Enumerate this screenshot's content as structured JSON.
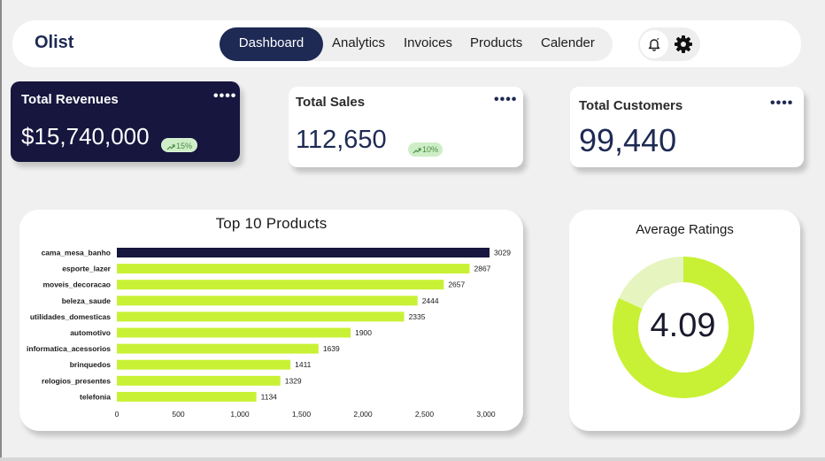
{
  "header": {
    "brand": "Olist",
    "nav": [
      "Dashboard",
      "Analytics",
      "Invoices",
      "Products",
      "Calender"
    ],
    "active_index": 0
  },
  "icons": [
    "bell-icon",
    "gear-icon",
    "more-dots-icon",
    "trend-up-icon"
  ],
  "colors": {
    "navy": "#1e2a54",
    "dark_card": "#16163f",
    "lime": "#c8f135",
    "lime_light": "#e6f5c0"
  },
  "cards": [
    {
      "title": "Total Revenues",
      "dots": "••••",
      "value": "$15,740,000",
      "badge": "15%"
    },
    {
      "title": "Total Sales",
      "dots": "••••",
      "value": "112,650",
      "badge": "10%"
    },
    {
      "title": "Total Customers",
      "dots": "••••",
      "value": "99,440"
    }
  ],
  "chart_data": {
    "type": "bar",
    "orientation": "horizontal",
    "title": "Top 10 Products",
    "categories": [
      "cama_mesa_banho",
      "esporte_lazer",
      "moveis_decoracao",
      "beleza_saude",
      "utilidades_domesticas",
      "automotivo",
      "informatica_acessorios",
      "brinquedos",
      "relogios_presentes",
      "telefonia"
    ],
    "values": [
      3029,
      2867,
      2657,
      2444,
      2335,
      1900,
      1639,
      1411,
      1329,
      1134
    ],
    "data_labels": [
      "3029",
      "2867",
      "2657",
      "2444",
      "2335",
      "1900",
      "1639",
      "1411",
      "1329",
      "1134"
    ],
    "highlight_index": 0,
    "colors": {
      "highlight": "#16163f",
      "default": "#c8f135"
    },
    "xlim": [
      0,
      3000
    ],
    "x_ticks": [
      0,
      500,
      1000,
      1500,
      2000,
      2500,
      3000
    ],
    "x_tick_labels": [
      "0",
      "500",
      "1,000",
      "1,500",
      "2,000",
      "2,500",
      "3,000"
    ],
    "grid": false
  },
  "ratings": {
    "title": "Average Ratings",
    "value": "4.09",
    "score": 4.09,
    "max": 5
  }
}
